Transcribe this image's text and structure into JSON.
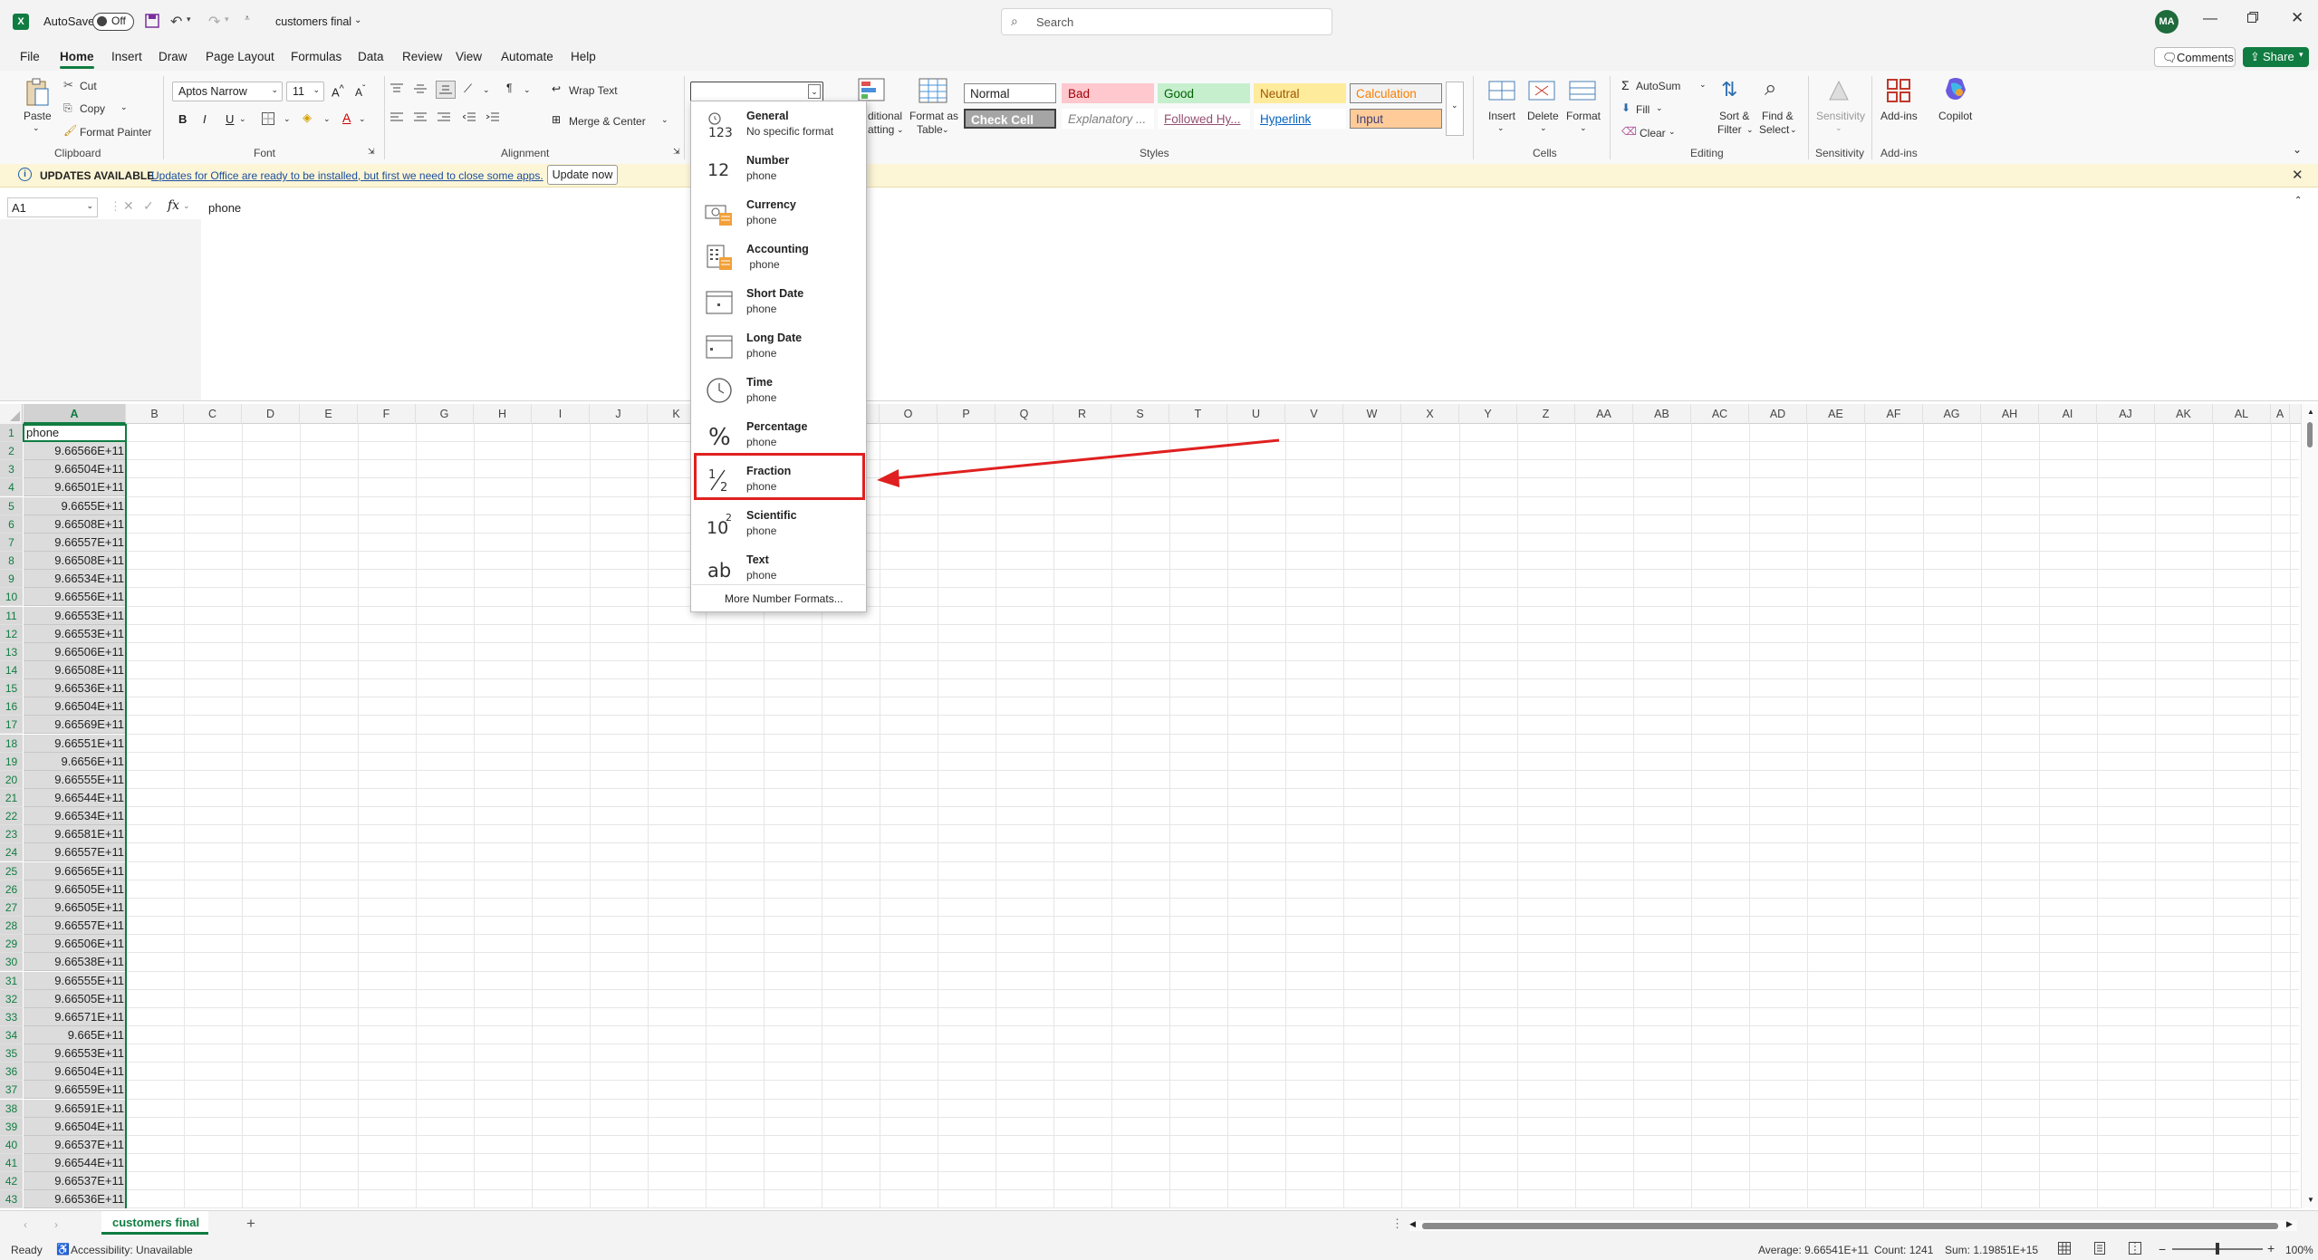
{
  "titlebar": {
    "autosave_label": "AutoSave",
    "autosave_state": "Off",
    "filename": "customers final",
    "search_placeholder": "Search",
    "avatar_initials": "MA"
  },
  "menu": {
    "items": [
      "File",
      "Home",
      "Insert",
      "Draw",
      "Page Layout",
      "Formulas",
      "Data",
      "Review",
      "View",
      "Automate",
      "Help"
    ],
    "active": "Home",
    "comments": "Comments",
    "share": "Share"
  },
  "ribbon": {
    "clipboard": {
      "paste": "Paste",
      "cut": "Cut",
      "copy": "Copy",
      "format_painter": "Format Painter",
      "label": "Clipboard"
    },
    "font": {
      "name": "Aptos Narrow",
      "size": "11",
      "label": "Font"
    },
    "alignment": {
      "wrap_text": "Wrap Text",
      "merge_center": "Merge & Center",
      "label": "Alignment"
    },
    "number": {
      "format_value": ""
    },
    "conditional": "Conditional Formatting",
    "conditional_visible": [
      "ditional",
      "atting"
    ],
    "format_as_table": [
      "Format as",
      "Table"
    ],
    "styles": {
      "label": "Styles",
      "items": [
        {
          "name": "Normal",
          "bg": "#ffffff",
          "fg": "#222222"
        },
        {
          "name": "Bad",
          "bg": "#ffc7ce",
          "fg": "#9c0006"
        },
        {
          "name": "Good",
          "bg": "#c6efce",
          "fg": "#006100"
        },
        {
          "name": "Neutral",
          "bg": "#ffeb9c",
          "fg": "#9c5700"
        },
        {
          "name": "Calculation",
          "bg": "#f2f2f2",
          "fg": "#fa7d00"
        },
        {
          "name": "Check Cell",
          "bg": "#a5a5a5",
          "fg": "#ffffff"
        },
        {
          "name": "Explanatory ...",
          "bg": "#ffffff",
          "fg": "#7f7f7f"
        },
        {
          "name": "Followed Hy...",
          "bg": "#ffffff",
          "fg": "#954f72"
        },
        {
          "name": "Hyperlink",
          "bg": "#ffffff",
          "fg": "#0563c1"
        },
        {
          "name": "Input",
          "bg": "#ffcc99",
          "fg": "#3f3f76"
        }
      ]
    },
    "cells": {
      "insert": "Insert",
      "delete": "Delete",
      "format": "Format",
      "label": "Cells"
    },
    "editing": {
      "autosum": "AutoSum",
      "fill": "Fill",
      "clear": "Clear",
      "sort_filter": [
        "Sort &",
        "Filter"
      ],
      "find_select": [
        "Find &",
        "Select"
      ],
      "label": "Editing"
    },
    "sensitivity": {
      "button": "Sensitivity",
      "label": "Sensitivity"
    },
    "addins": {
      "button": "Add-ins",
      "label": "Add-ins"
    },
    "copilot": "Copilot"
  },
  "update_bar": {
    "title": "UPDATES AVAILABLE",
    "message": "Updates for Office are ready to be installed, but first we need to close some apps.",
    "button": "Update now"
  },
  "formula_bar": {
    "name_box": "A1",
    "fx": "fx",
    "content": "phone"
  },
  "grid": {
    "columns": [
      "A",
      "B",
      "C",
      "D",
      "E",
      "F",
      "G",
      "H",
      "I",
      "J",
      "K",
      "L",
      "M",
      "N",
      "O",
      "P",
      "Q",
      "R",
      "S",
      "T",
      "U",
      "V",
      "W",
      "X",
      "Y",
      "Z",
      "AA",
      "AB",
      "AC",
      "AD",
      "AE",
      "AF",
      "AG",
      "AH",
      "AI",
      "AJ",
      "AK",
      "AL",
      "A"
    ],
    "rows": [
      "1",
      "2",
      "3",
      "4",
      "5",
      "6",
      "7",
      "8",
      "9",
      "10",
      "11",
      "12",
      "13",
      "14",
      "15",
      "16",
      "17",
      "18",
      "19",
      "20",
      "21",
      "22",
      "23",
      "24",
      "25",
      "26",
      "27",
      "28",
      "29",
      "30",
      "31",
      "32",
      "33",
      "34",
      "35",
      "36",
      "37",
      "38",
      "39",
      "40",
      "41",
      "42",
      "43"
    ],
    "col_a": [
      "phone",
      "9.66566E+11",
      "9.66504E+11",
      "9.66501E+11",
      "9.6655E+11",
      "9.66508E+11",
      "9.66557E+11",
      "9.66508E+11",
      "9.66534E+11",
      "9.66556E+11",
      "9.66553E+11",
      "9.66553E+11",
      "9.66506E+11",
      "9.66508E+11",
      "9.66536E+11",
      "9.66504E+11",
      "9.66569E+11",
      "9.66551E+11",
      "9.6656E+11",
      "9.66555E+11",
      "9.66544E+11",
      "9.66534E+11",
      "9.66581E+11",
      "9.66557E+11",
      "9.66565E+11",
      "9.66505E+11",
      "9.66505E+11",
      "9.66557E+11",
      "9.66506E+11",
      "9.66538E+11",
      "9.66555E+11",
      "9.66505E+11",
      "9.66571E+11",
      "9.665E+11",
      "9.66553E+11",
      "9.66504E+11",
      "9.66559E+11",
      "9.66591E+11",
      "9.66504E+11",
      "9.66537E+11",
      "9.66544E+11",
      "9.66537E+11",
      "9.66536E+11"
    ]
  },
  "number_format_menu": {
    "items": [
      {
        "icon": "general-123-icon",
        "title": "General",
        "sub": "No specific format"
      },
      {
        "icon": "number-12-icon",
        "title": "Number",
        "sub": "phone"
      },
      {
        "icon": "currency-icon",
        "title": "Currency",
        "sub": "phone"
      },
      {
        "icon": "accounting-icon",
        "title": "Accounting",
        "sub": " phone"
      },
      {
        "icon": "short-date-calendar-icon",
        "title": "Short Date",
        "sub": "phone"
      },
      {
        "icon": "long-date-calendar-icon",
        "title": "Long Date",
        "sub": "phone"
      },
      {
        "icon": "clock-icon",
        "title": "Time",
        "sub": "phone"
      },
      {
        "icon": "percent-icon",
        "title": "Percentage",
        "sub": "phone"
      },
      {
        "icon": "fraction-icon",
        "title": "Fraction",
        "sub": "phone"
      },
      {
        "icon": "scientific-icon",
        "title": "Scientific",
        "sub": "phone"
      },
      {
        "icon": "text-ab-icon",
        "title": "Text",
        "sub": "phone"
      }
    ],
    "highlighted": "Fraction",
    "more": "More Number Formats..."
  },
  "sheets": {
    "tabs": [
      "customers final"
    ],
    "active": "customers final"
  },
  "status": {
    "ready": "Ready",
    "accessibility": "Accessibility: Unavailable",
    "average": "Average: 9.66541E+11",
    "count": "Count: 1241",
    "sum": "Sum: 1.19851E+15",
    "zoom": "100%"
  },
  "colors": {
    "accent": "#107c41",
    "annotation": "#e02020"
  }
}
